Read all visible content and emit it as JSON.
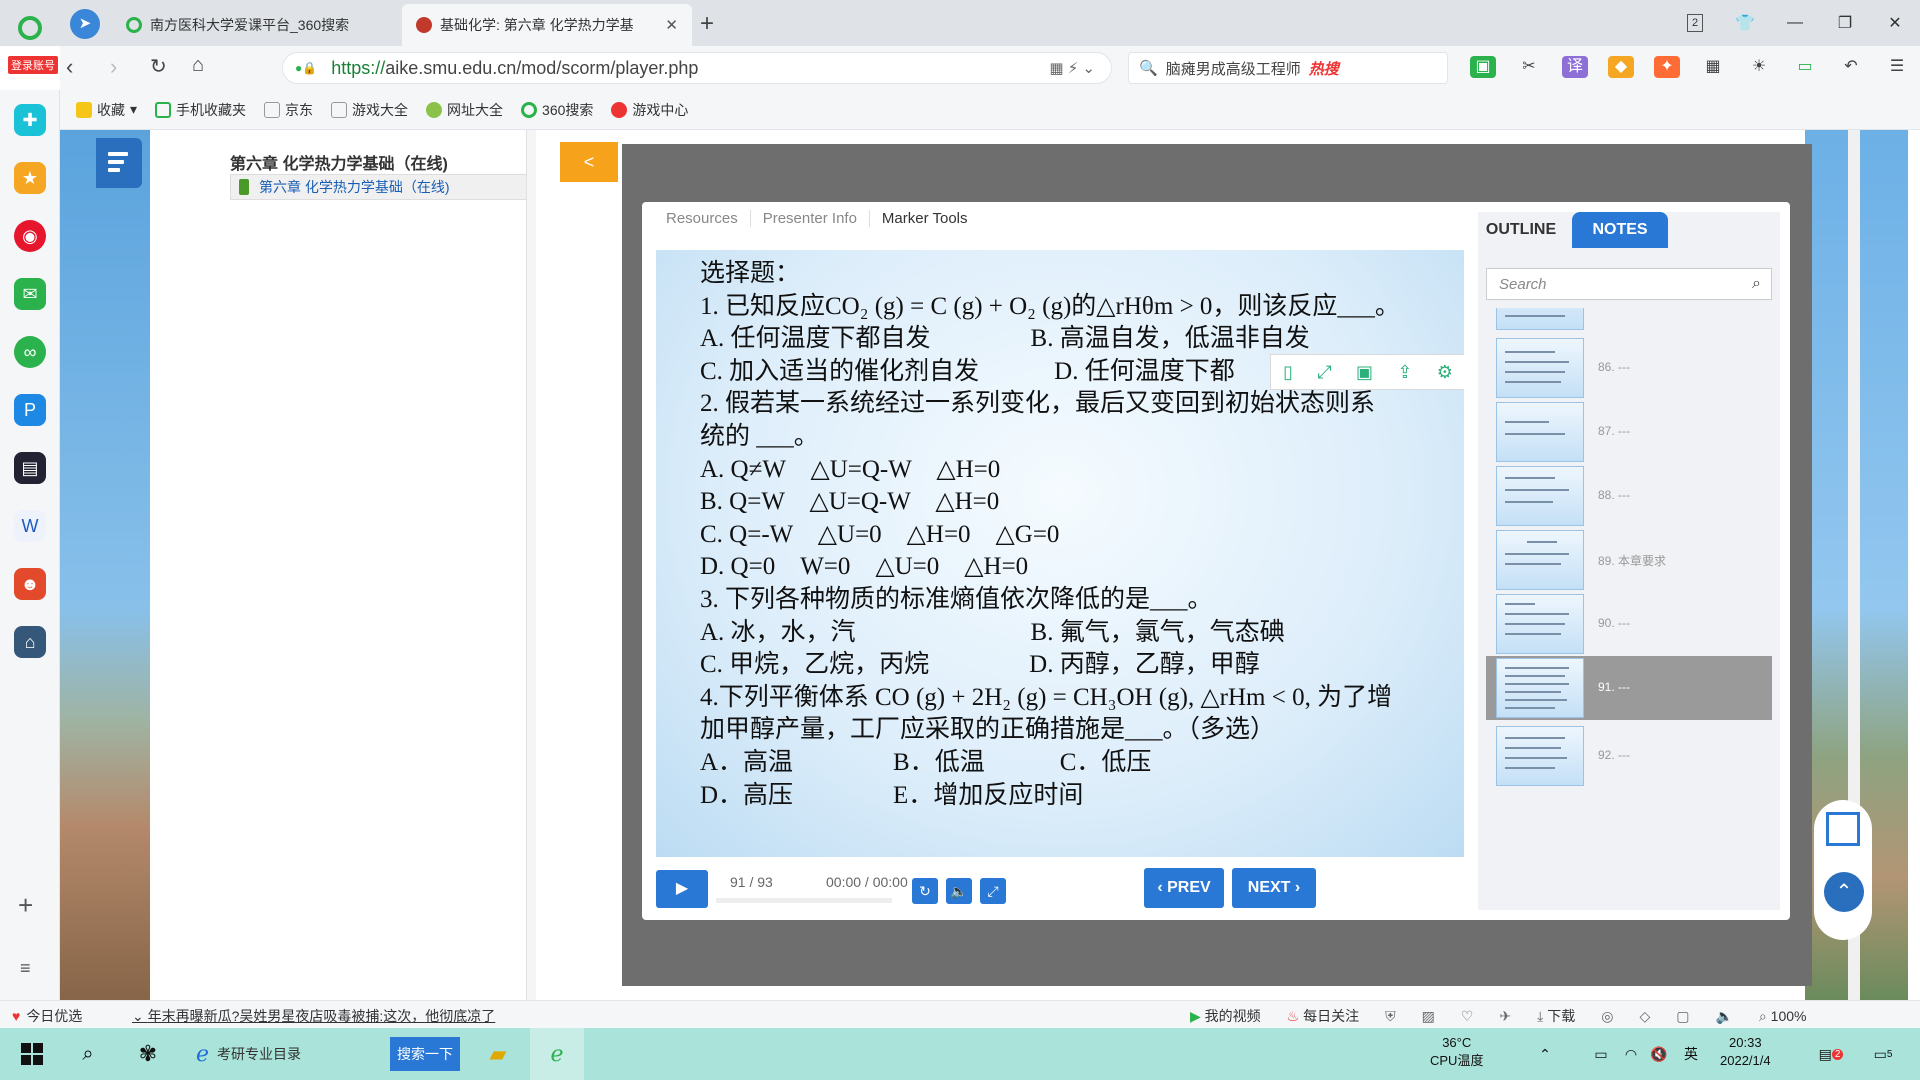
{
  "browser": {
    "account_label": "登录账号",
    "tabs": [
      {
        "title": "南方医科大学爱课平台_360搜索",
        "active": false
      },
      {
        "title": "基础化学: 第六章 化学热力学基",
        "active": true
      }
    ],
    "tab_count": "2",
    "url": {
      "protocol": "https://",
      "rest": "aike.smu.edu.cn/mod/scorm/player.php"
    },
    "hot_search": {
      "text": "脑瘫男成高级工程师",
      "badge": "热搜"
    },
    "bookmarks": [
      "收藏",
      "手机收藏夹",
      "京东",
      "游戏大全",
      "网址大全",
      "360搜索",
      "游戏中心"
    ]
  },
  "course": {
    "title": "第六章 化学热力学基础（在线)",
    "item": "第六章 化学热力学基础（在线)",
    "collapse_label": "<"
  },
  "player": {
    "topnav": [
      "Resources",
      "Presenter Info",
      "Marker Tools"
    ],
    "slide": {
      "lines": [
        "选择题：",
        "1. 已知反应CO₂ (g) = C (g) + O₂ (g)的△rHθm > 0，则该反应___。",
        "A. 任何温度下都自发　　　　B. 高温自发，低温非自发",
        "C. 加入适当的催化剂自发　　　D. 任何温度下都",
        "2. 假若某一系统经过一系列变化，最后又变回到初始状态则系",
        "统的 ___。",
        "A. Q≠W　△U=Q-W　△H=0",
        "B. Q=W　△U=Q-W　△H=0",
        "C. Q=-W　△U=0　△H=0　△G=0",
        "D. Q=0　W=0　△U=0　△H=0",
        " 3. 下列各种物质的标准熵值依次降低的是___。",
        "A. 冰，水，汽　　　　　　　B. 氟气，氯气，气态碘",
        "C. 甲烷，乙烷，丙烷　　　　D. 丙醇，乙醇，甲醇",
        "4.下列平衡体系 CO (g) + 2H₂ (g) = CH₃OH (g), △rHm < 0, 为了增",
        "加甲醇产量，工厂应采取的正确措施是___。（多选）",
        " A．高温　　　　B．低温　　　C．低压",
        " D．高压　　　　E．增加反应时间"
      ]
    },
    "slide_count": "91 / 93",
    "time": "00:00 / 00:00",
    "prev_label": "PREV",
    "next_label": "NEXT",
    "progress": 0
  },
  "sidepanel": {
    "tab_outline": "OUTLINE",
    "tab_notes": "NOTES",
    "search_placeholder": "Search",
    "thumbs": [
      {
        "label": "",
        "selected": false
      },
      {
        "label": "86. ---",
        "selected": false
      },
      {
        "label": "87. ---",
        "selected": false
      },
      {
        "label": "88. ---",
        "selected": false
      },
      {
        "label": "89. 本章要求",
        "selected": false
      },
      {
        "label": "90. ---",
        "selected": false
      },
      {
        "label": "91. ---",
        "selected": true
      },
      {
        "label": "92. ---",
        "selected": false
      }
    ]
  },
  "statusbar": {
    "today": "今日优选",
    "news": "年末再曝新瓜?吴姓男星夜店吸毒被捕:这次，他彻底凉了",
    "my_video": "我的视频",
    "daily": "每日关注",
    "download": "下载",
    "zoom": "100%"
  },
  "taskbar": {
    "ie_label": "考研专业目录",
    "search_btn": "搜索一下",
    "temp": "36°C",
    "temp_label": "CPU温度",
    "ime": "英",
    "time": "20:33",
    "date": "2022/1/4",
    "notif_count": "5",
    "badge_count": "2"
  }
}
